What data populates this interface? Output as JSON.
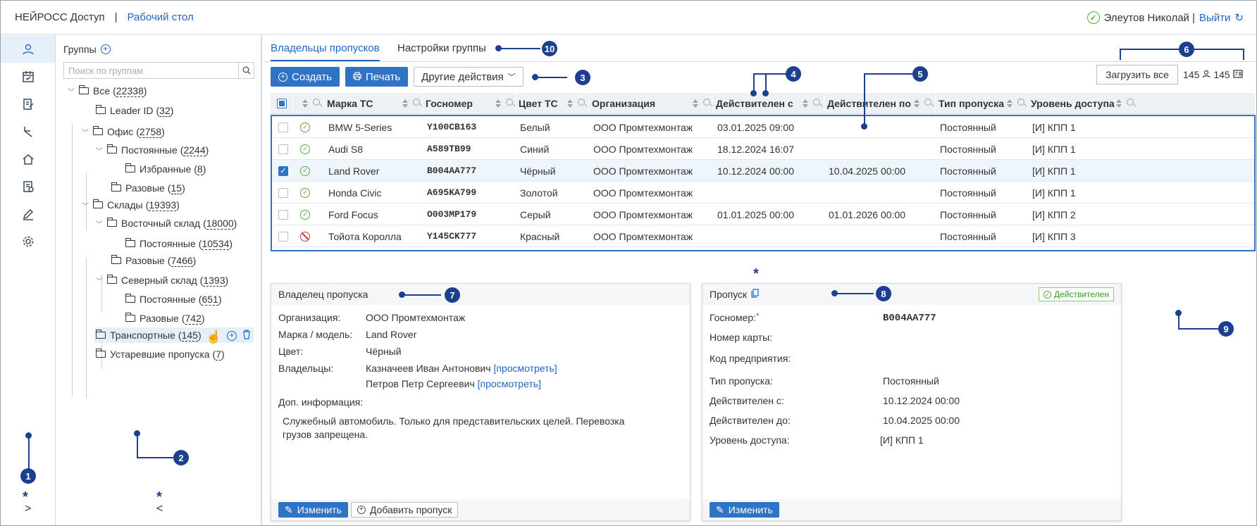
{
  "header": {
    "brand": "НЕЙРОСС Доступ",
    "separator": "|",
    "desktop_link": "Рабочий стол",
    "user": "Элеутов Николай |",
    "logout": "Выйти"
  },
  "groups": {
    "title": "Группы",
    "search_placeholder": "Поиск по группам",
    "tree": [
      {
        "name": "Все",
        "count": "22338"
      },
      {
        "name": "Leader ID",
        "count": "32"
      },
      {
        "name": "Офис",
        "count": "2758"
      },
      {
        "name": "Постоянные",
        "count": "2244"
      },
      {
        "name": "Избранные",
        "count": "8"
      },
      {
        "name": "Разовые",
        "count": "15"
      },
      {
        "name": "Склады",
        "count": "19393"
      },
      {
        "name": "Восточный склад",
        "count": "18000"
      },
      {
        "name": "Постоянные",
        "count": "10534"
      },
      {
        "name": "Разовые",
        "count": "7466"
      },
      {
        "name": "Северный склад",
        "count": "1393"
      },
      {
        "name": "Постоянные",
        "count": "651"
      },
      {
        "name": "Разовые",
        "count": "742"
      },
      {
        "name": "Транспортные",
        "count": "145"
      },
      {
        "name": "Устаревшие пропуска",
        "count": "7"
      }
    ]
  },
  "tabs": [
    "Владельцы пропусков",
    "Настройки группы"
  ],
  "toolbar": {
    "create": "Создать",
    "print": "Печать",
    "other": "Другие действия",
    "load_all": "Загрузить все",
    "count_people": "145",
    "count_cards": "145"
  },
  "table": {
    "columns": [
      "Марка ТС",
      "Госномер",
      "Цвет ТС",
      "Организация",
      "Действителен с",
      "Действителен по",
      "Тип пропуска",
      "Уровень доступа"
    ],
    "rows": [
      {
        "model": "BMW 5-Series",
        "plate": "Y100CB163",
        "color": "Белый",
        "org": "ООО Промтехмонтаж",
        "from": "03.01.2025 09:00",
        "to": "",
        "type": "Постоянный",
        "level": "[И] КПП 1",
        "status": "ok",
        "checked": false
      },
      {
        "model": "Audi S8",
        "plate": "A589TB99",
        "color": "Синий",
        "org": "ООО Промтехмонтаж",
        "from": "18.12.2024 16:07",
        "to": "",
        "type": "Постоянный",
        "level": "[И] КПП 1",
        "status": "ok",
        "checked": false
      },
      {
        "model": "Land Rover",
        "plate": "B004AA777",
        "color": "Чёрный",
        "org": "ООО Промтехмонтаж",
        "from": "10.12.2024 00:00",
        "to": "10.04.2025 00:00",
        "type": "Постоянный",
        "level": "[И] КПП 1",
        "status": "ok",
        "checked": true
      },
      {
        "model": "Honda Civic",
        "plate": "A695KA799",
        "color": "Золотой",
        "org": "ООО Промтехмонтаж",
        "from": "",
        "to": "",
        "type": "Постоянный",
        "level": "[И] КПП 1",
        "status": "ok",
        "checked": false
      },
      {
        "model": "Ford Focus",
        "plate": "O003MP179",
        "color": "Серый",
        "org": "ООО Промтехмонтаж",
        "from": "01.01.2025 00:00",
        "to": "01.01.2026 00:00",
        "type": "Постоянный",
        "level": "[И] КПП 2",
        "status": "ok",
        "checked": false
      },
      {
        "model": "Тойота Королла",
        "plate": "Y145CK777",
        "color": "Красный",
        "org": "ООО Промтехмонтаж",
        "from": "",
        "to": "",
        "type": "Постоянный",
        "level": "[И] КПП 3",
        "status": "blocked",
        "checked": false
      }
    ]
  },
  "owner": {
    "title": "Владелец пропуска",
    "labels": {
      "org": "Организация:",
      "model": "Марка / модель:",
      "color": "Цвет:",
      "owners": "Владельцы:",
      "info": "Доп. информация:"
    },
    "org": "ООО Промтехмонтаж",
    "model": "Land Rover",
    "color": "Чёрный",
    "owner1": "Казначеев Иван Антонович",
    "owner2": "Петров Петр Сергеевич",
    "view": "[просмотреть]",
    "info": "Служебный автомобиль. Только для представительских целей. Перевозка грузов запрещена.",
    "edit": "Изменить",
    "add_pass": "Добавить пропуск"
  },
  "pass": {
    "title": "Пропуск",
    "status": "Действителен",
    "labels": {
      "plate": "Госномер:",
      "required": "*",
      "card": "Номер карты:",
      "code": "Код предприятия:",
      "type": "Тип пропуска:",
      "from": "Действителен с:",
      "to": "Действителен до:",
      "level": "Уровень доступа:"
    },
    "plate": "B004AA777",
    "type": "Постоянный",
    "from": "10.12.2024 00:00",
    "to": "10.04.2025 00:00",
    "level": "[И] КПП 1",
    "edit": "Изменить"
  },
  "annotations": [
    "1",
    "2",
    "3",
    "4",
    "5",
    "6",
    "7",
    "8",
    "9",
    "10"
  ],
  "markers": {
    "star": "*",
    "collapse_right": ">",
    "collapse_left": "<"
  },
  "colors": {
    "accent": "#2f73c4",
    "annotation": "#1d3f8f",
    "ok": "#52b03a",
    "blocked": "#d9303a"
  }
}
